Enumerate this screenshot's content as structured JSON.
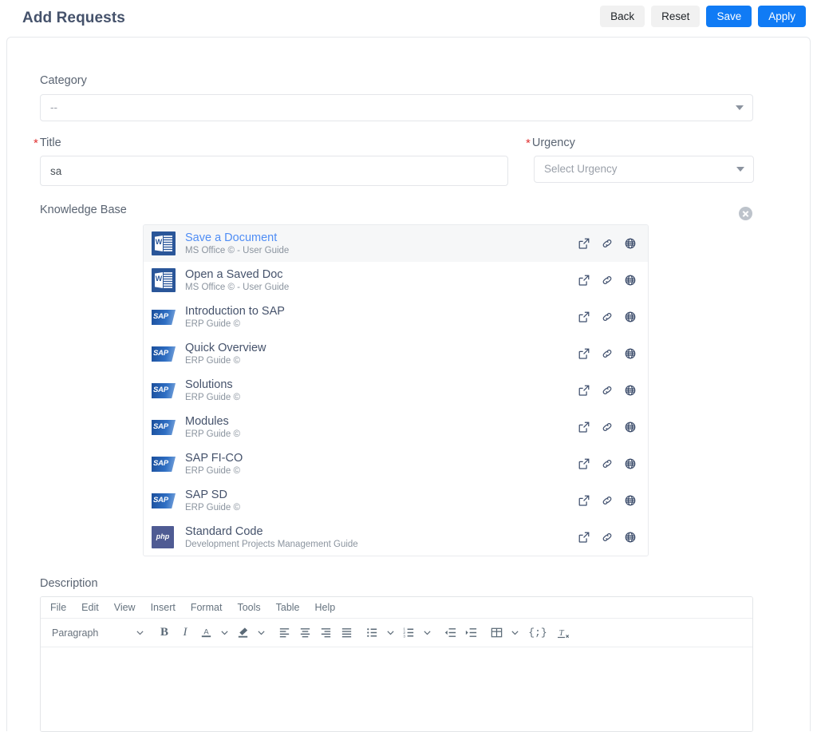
{
  "header": {
    "title": "Add Requests",
    "buttons": [
      {
        "label": "Back",
        "style": "light"
      },
      {
        "label": "Reset",
        "style": "light"
      },
      {
        "label": "Save",
        "style": "primary"
      },
      {
        "label": "Apply",
        "style": "primary"
      }
    ]
  },
  "form": {
    "category": {
      "label": "Category",
      "value": "--",
      "caret_icon": "chevron-down-icon"
    },
    "title": {
      "label": "Title",
      "required": true,
      "required_marker": "*",
      "value": "sa",
      "placeholder": ""
    },
    "urgency": {
      "label": "Urgency",
      "required": true,
      "required_marker": "*",
      "value": "",
      "placeholder": "Select Urgency",
      "caret_icon": "chevron-down-icon"
    },
    "knowledge_base": {
      "label": "Knowledge Base",
      "clear_icon": "close-circle-icon",
      "row_actions": [
        "external-link-icon",
        "link-icon",
        "globe-icon"
      ],
      "items": [
        {
          "title": "Save a Document",
          "subtitle": "MS Office © - User Guide",
          "icon": "ms-word-icon",
          "selected": true
        },
        {
          "title": "Open a Saved Doc",
          "subtitle": "MS Office © - User Guide",
          "icon": "ms-word-icon",
          "selected": false
        },
        {
          "title": "Introduction to SAP",
          "subtitle": "ERP Guide ©",
          "icon": "sap-icon",
          "selected": false
        },
        {
          "title": "Quick Overview",
          "subtitle": "ERP Guide ©",
          "icon": "sap-icon",
          "selected": false
        },
        {
          "title": "Solutions",
          "subtitle": "ERP Guide ©",
          "icon": "sap-icon",
          "selected": false
        },
        {
          "title": "Modules",
          "subtitle": "ERP Guide ©",
          "icon": "sap-icon",
          "selected": false
        },
        {
          "title": "SAP FI-CO",
          "subtitle": "ERP Guide ©",
          "icon": "sap-icon",
          "selected": false
        },
        {
          "title": "SAP SD",
          "subtitle": "ERP Guide ©",
          "icon": "sap-icon",
          "selected": false
        },
        {
          "title": "Standard Code",
          "subtitle": "Development Projects Management Guide",
          "icon": "php-icon",
          "selected": false
        }
      ]
    },
    "description": {
      "label": "Description",
      "editor": {
        "menu": [
          "File",
          "Edit",
          "View",
          "Insert",
          "Format",
          "Tools",
          "Table",
          "Help"
        ],
        "block_format": "Paragraph",
        "body_text": "",
        "tools": [
          "bold-icon",
          "italic-icon",
          "text-color-icon",
          "text-color-chevron-icon",
          "highlight-color-icon",
          "highlight-color-chevron-icon",
          "align-left-icon",
          "align-center-icon",
          "align-right-icon",
          "align-justify-icon",
          "bullet-list-icon",
          "bullet-list-chevron-icon",
          "numbered-list-icon",
          "numbered-list-chevron-icon",
          "outdent-icon",
          "indent-icon",
          "table-icon",
          "table-chevron-icon",
          "source-code-icon",
          "clear-formatting-icon"
        ],
        "source_code_glyph": "{;}"
      }
    }
  },
  "colors": {
    "primary": "#107bf5",
    "light_button": "#f1f1f1",
    "required": "#e03131",
    "link": "#4f8df5",
    "text": "#45526b",
    "muted": "#8b949f",
    "ms_word": "#2a5699",
    "sap": "#1b4f9c",
    "php": "#4f5b93"
  }
}
